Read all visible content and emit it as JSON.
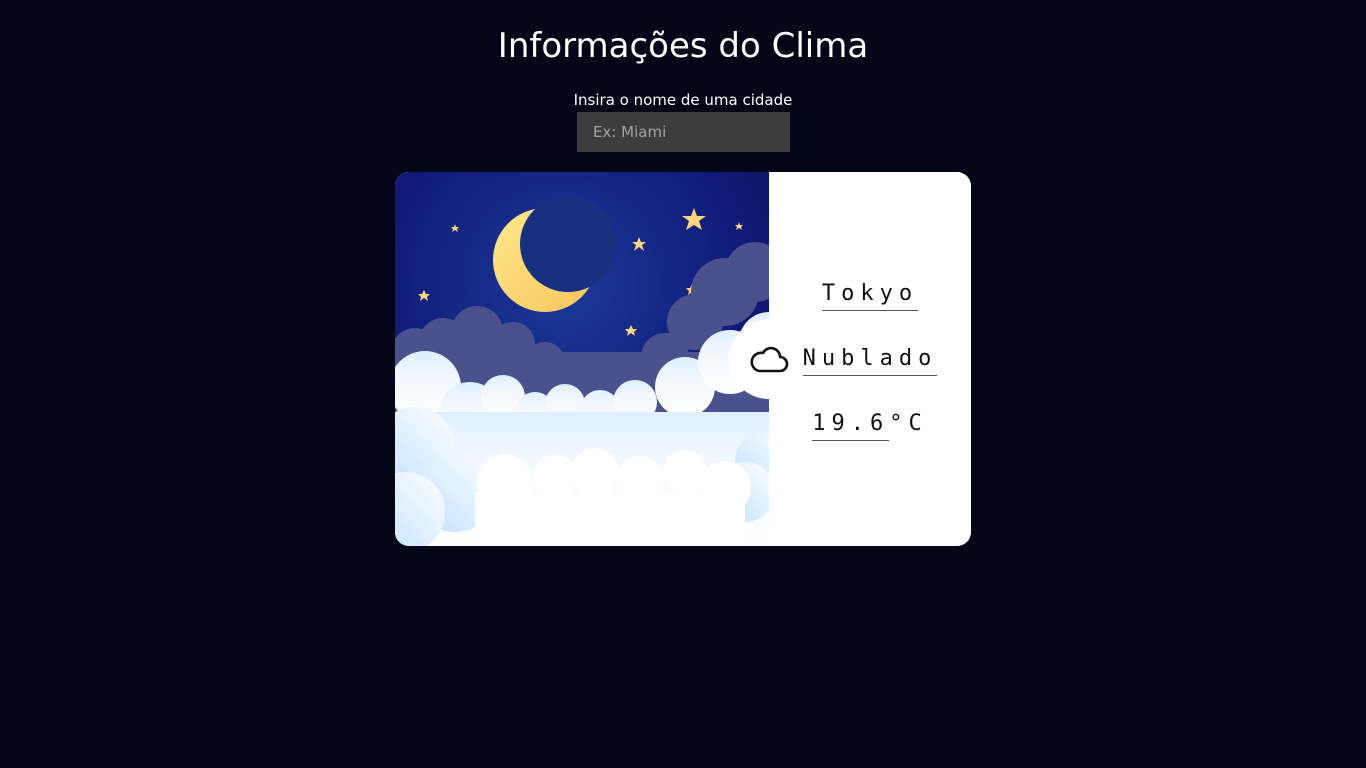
{
  "header": {
    "title": "Informações do Clima"
  },
  "search": {
    "label": "Insira o nome de uma cidade",
    "placeholder": "Ex: Miami",
    "value": ""
  },
  "weather": {
    "city": "Tokyo",
    "condition": "Nublado",
    "temperature": "19.6",
    "unit": "°C",
    "icon": "cloud-icon",
    "scene": "night-moon-clouds"
  },
  "colors": {
    "background": "#020617",
    "input_bg": "#3d3d3d",
    "sky_dark": "#0a0f5c",
    "moon": "#fcd77a",
    "card": "#ffffff"
  }
}
